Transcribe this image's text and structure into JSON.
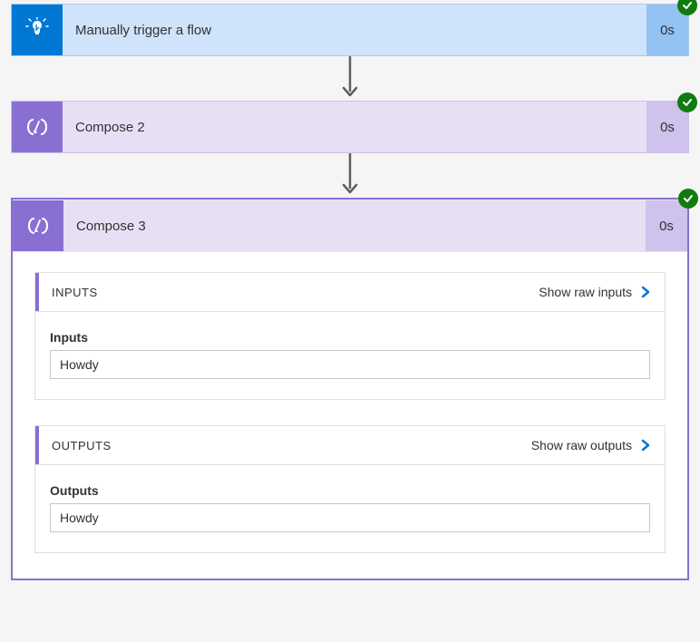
{
  "cards": [
    {
      "title": "Manually trigger a flow",
      "duration": "0s",
      "type": "trigger"
    },
    {
      "title": "Compose 2",
      "duration": "0s",
      "type": "compose"
    },
    {
      "title": "Compose 3",
      "duration": "0s",
      "type": "compose",
      "expanded": true
    }
  ],
  "expanded": {
    "inputs": {
      "header": "INPUTS",
      "link": "Show raw inputs",
      "label": "Inputs",
      "value": "Howdy"
    },
    "outputs": {
      "header": "OUTPUTS",
      "link": "Show raw outputs",
      "label": "Outputs",
      "value": "Howdy"
    }
  }
}
